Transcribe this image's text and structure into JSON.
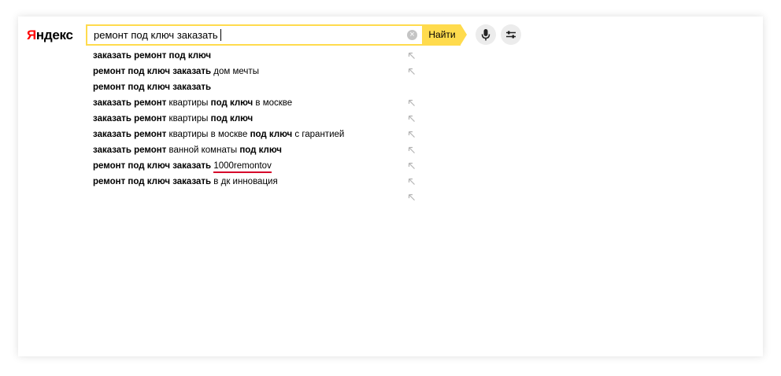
{
  "logo": {
    "first": "Я",
    "rest": "ндекс"
  },
  "search": {
    "value": "ремонт под ключ заказать"
  },
  "find_button": {
    "label": "Найти"
  },
  "clear_icon": {
    "name": "clear-icon",
    "glyph": "×"
  },
  "suggestions": [
    {
      "parts": [
        {
          "t": "заказать ремонт под ключ",
          "b": true
        }
      ],
      "arrow": true
    },
    {
      "parts": [
        {
          "t": "ремонт под ключ заказать",
          "b": true
        },
        {
          "t": " дом мечты",
          "b": false
        }
      ],
      "arrow": true
    },
    {
      "parts": [
        {
          "t": "ремонт под ключ заказать",
          "b": true
        }
      ],
      "arrow": false
    },
    {
      "parts": [
        {
          "t": "заказать ремонт",
          "b": true
        },
        {
          "t": " квартиры ",
          "b": false
        },
        {
          "t": "под ключ",
          "b": true
        },
        {
          "t": " в москве",
          "b": false
        }
      ],
      "arrow": true
    },
    {
      "parts": [
        {
          "t": "заказать ремонт",
          "b": true
        },
        {
          "t": " квартиры ",
          "b": false
        },
        {
          "t": "под ключ",
          "b": true
        }
      ],
      "arrow": true
    },
    {
      "parts": [
        {
          "t": "заказать ремонт",
          "b": true
        },
        {
          "t": " квартиры в москве ",
          "b": false
        },
        {
          "t": "под ключ",
          "b": true
        },
        {
          "t": " с гарантией",
          "b": false
        }
      ],
      "arrow": true
    },
    {
      "parts": [
        {
          "t": "заказать ремонт",
          "b": true
        },
        {
          "t": " ванной комнаты ",
          "b": false
        },
        {
          "t": "под ключ",
          "b": true
        }
      ],
      "arrow": true
    },
    {
      "parts": [
        {
          "t": "ремонт под ключ заказать",
          "b": true
        },
        {
          "t": " ",
          "b": false
        },
        {
          "t": "1000remontov",
          "b": false,
          "link": true
        }
      ],
      "arrow": true
    },
    {
      "parts": [
        {
          "t": "ремонт под ключ заказать",
          "b": true
        },
        {
          "t": " в дк инновация",
          "b": false
        }
      ],
      "arrow": true
    },
    {
      "parts": [],
      "arrow": true
    }
  ],
  "icons": {
    "mic": "microphone-icon",
    "settings": "settings-sliders-icon",
    "arrow": "arrow-up-left-icon"
  },
  "colors": {
    "accent": "#ffdb4d",
    "logo_red": "#ff0000",
    "underline": "#d6002a",
    "muted": "#c4c4c4"
  }
}
